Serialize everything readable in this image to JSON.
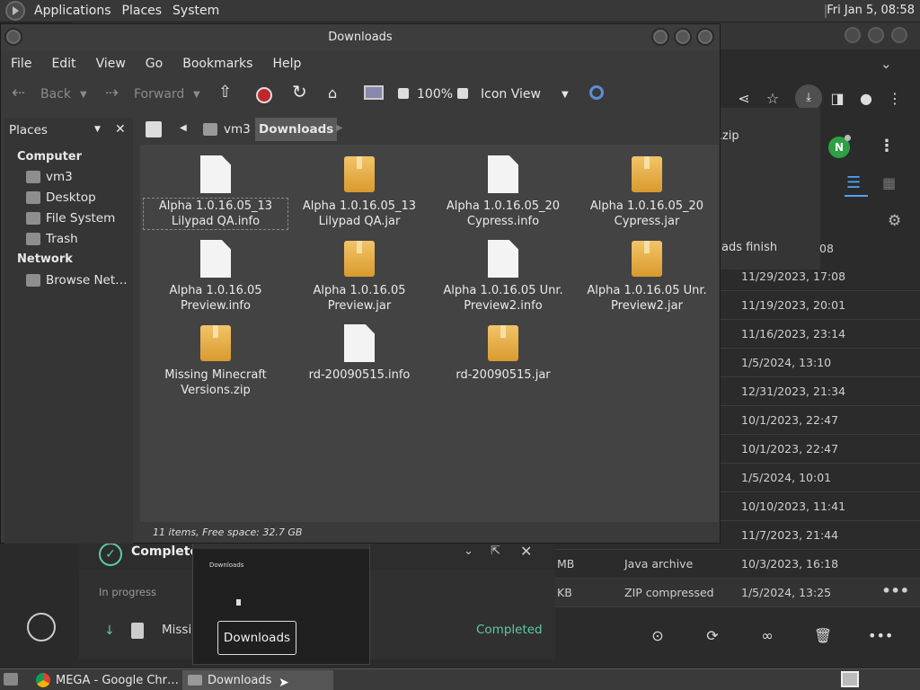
{
  "top_panel": {
    "menus": [
      "Applications",
      "Places",
      "System"
    ],
    "clock": "Fri Jan  5, 08:58"
  },
  "chrome_bg": {
    "partial_zip_text": "s.zip",
    "partial_popup_text": "ads finish",
    "partial_popup_time": "08",
    "avatar_letter": "N",
    "rows": [
      {
        "size": "",
        "type": "",
        "date": "11/29/2023, 17:08"
      },
      {
        "size": "",
        "type": "",
        "date": "11/19/2023, 20:01"
      },
      {
        "size": "",
        "type": "",
        "date": "11/16/2023, 23:14"
      },
      {
        "size": "",
        "type": "",
        "date": "1/5/2024, 13:10"
      },
      {
        "size": "",
        "type": "",
        "date": "12/31/2023, 21:34"
      },
      {
        "size": "",
        "type": "",
        "date": "10/1/2023, 22:47"
      },
      {
        "size": "",
        "type": "",
        "date": "10/1/2023, 22:47"
      },
      {
        "size": "",
        "type": "",
        "date": "1/5/2024, 10:01"
      },
      {
        "size": "",
        "type": "",
        "date": "10/10/2023, 11:41"
      },
      {
        "size": "",
        "type": "",
        "date": "11/7/2023, 21:44"
      },
      {
        "size": "MB",
        "type": "Java archive",
        "date": "10/3/2023, 16:18"
      },
      {
        "size": "KB",
        "type": "ZIP compressed",
        "date": "1/5/2024, 13:25"
      }
    ]
  },
  "transfer": {
    "title": "Completed",
    "in_progress": "In progress",
    "item_name": "Missi",
    "item_status": "Completed"
  },
  "fm": {
    "title": "Downloads",
    "menus": [
      "File",
      "Edit",
      "View",
      "Go",
      "Bookmarks",
      "Help"
    ],
    "toolbar": {
      "back": "Back",
      "forward": "Forward",
      "zoom": "100%",
      "view_mode": "Icon View"
    },
    "sidebar": {
      "dropdown": "Places",
      "sections": [
        {
          "header": "Computer",
          "items": [
            "vm3",
            "Desktop",
            "File System",
            "Trash"
          ]
        },
        {
          "header": "Network",
          "items": [
            "Browse Net…"
          ]
        }
      ]
    },
    "path": [
      "vm3",
      "Downloads"
    ],
    "items": [
      {
        "l1": "Alpha 1.0.16.05_13",
        "l2": "Lilypad QA.info",
        "kind": "file"
      },
      {
        "l1": "Alpha 1.0.16.05_13",
        "l2": "Lilypad QA.jar",
        "kind": "box"
      },
      {
        "l1": "Alpha 1.0.16.05_20",
        "l2": "Cypress.info",
        "kind": "file"
      },
      {
        "l1": "Alpha 1.0.16.05_20",
        "l2": "Cypress.jar",
        "kind": "box"
      },
      {
        "l1": "Alpha 1.0.16.05",
        "l2": "Preview.info",
        "kind": "file"
      },
      {
        "l1": "Alpha 1.0.16.05",
        "l2": "Preview.jar",
        "kind": "box"
      },
      {
        "l1": "Alpha 1.0.16.05 Unr.",
        "l2": "Preview2.info",
        "kind": "file"
      },
      {
        "l1": "Alpha 1.0.16.05 Unr.",
        "l2": "Preview2.jar",
        "kind": "box"
      },
      {
        "l1": "Missing Minecraft",
        "l2": "Versions.zip",
        "kind": "box"
      },
      {
        "l1": "rd-20090515.info",
        "l2": "",
        "kind": "file"
      },
      {
        "l1": "rd-20090515.jar",
        "l2": "",
        "kind": "box"
      }
    ],
    "status": "11 items, Free space: 32.7 GB"
  },
  "taskbar": {
    "tasks": [
      "MEGA - Google Chr…",
      "Downloads"
    ],
    "tooltip": "Downloads",
    "thumb_title": "Downloads"
  }
}
